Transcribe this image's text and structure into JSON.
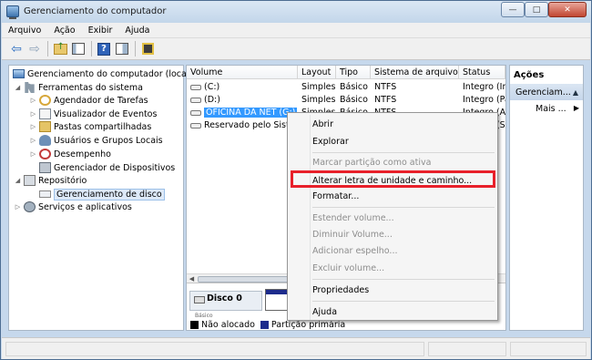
{
  "window": {
    "title": "Gerenciamento do computador",
    "buttons": {
      "minimize": "—",
      "maximize": "□",
      "close": "✕"
    }
  },
  "menubar": [
    "Arquivo",
    "Ação",
    "Exibir",
    "Ajuda"
  ],
  "toolbar": {
    "icons": [
      "back-icon",
      "forward-icon",
      "up-folder-icon",
      "show-hide-tree-icon",
      "help-icon",
      "properties-icon",
      "mmc-icon"
    ],
    "back_glyph": "⇦",
    "forward_glyph": "⇨",
    "help_glyph": "?"
  },
  "tree": {
    "root": "Gerenciamento do computador (local)",
    "system_tools": "Ferramentas do sistema",
    "task_scheduler": "Agendador de Tarefas",
    "event_viewer": "Visualizador de Eventos",
    "shared_folders": "Pastas compartilhadas",
    "local_users": "Usuários e Grupos Locais",
    "performance": "Desempenho",
    "device_manager": "Gerenciador de Dispositivos",
    "storage": "Repositório",
    "disk_management": "Gerenciamento de disco",
    "services": "Serviços e aplicativos"
  },
  "volumes": {
    "headers": {
      "volume": "Volume",
      "layout": "Layout",
      "type": "Tipo",
      "fs": "Sistema de arquivos",
      "status": "Status"
    },
    "rows": [
      {
        "volume": "(C:)",
        "layout": "Simples",
        "type": "Básico",
        "fs": "NTFS",
        "status": "Íntegro (Ini"
      },
      {
        "volume": "(D:)",
        "layout": "Simples",
        "type": "Básico",
        "fs": "NTFS",
        "status": "Íntegro (Pa"
      },
      {
        "volume": "OFICINA DA NET (G:)",
        "layout": "Simples",
        "type": "Básico",
        "fs": "NTFS",
        "status": "Íntegro (At"
      },
      {
        "volume": "Reservado pelo Sistema",
        "layout": "",
        "type": "",
        "fs": "",
        "status": "Íntegro (Sis"
      }
    ]
  },
  "disk_area": {
    "disk_label": "Disco 0",
    "disk_sub": "Básico",
    "legend_unallocated": "Não alocado",
    "legend_primary": "Partição primária"
  },
  "actions": {
    "title": "Ações",
    "section": "Gerenciam...",
    "more": "Mais ..."
  },
  "context_menu": {
    "open": "Abrir",
    "explore": "Explorar",
    "mark_active": "Marcar partição como ativa",
    "change_letter": "Alterar letra de unidade e caminho...",
    "format": "Formatar...",
    "extend": "Estender volume...",
    "shrink": "Diminuir Volume...",
    "add_mirror": "Adicionar espelho...",
    "delete": "Excluir volume...",
    "properties": "Propriedades",
    "help": "Ajuda"
  },
  "colors": {
    "highlight_border": "#e8202a",
    "selection": "#3399ff",
    "primary_partition": "#1d2b8c"
  }
}
